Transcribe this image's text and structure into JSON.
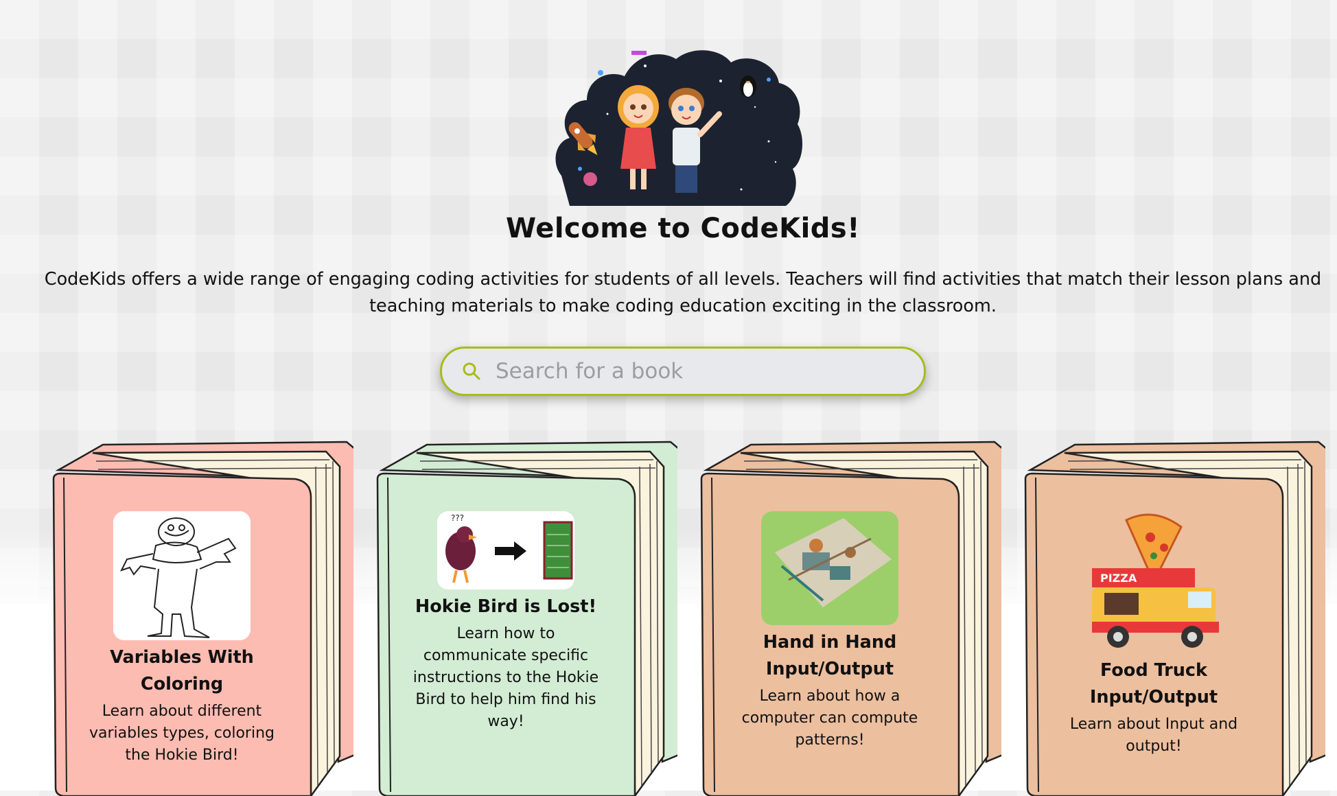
{
  "header": {
    "title": "Welcome to CodeKids!",
    "intro": "CodeKids offers a wide range of engaging coding activities for students of all levels. Teachers will find activities that match their lesson plans and teaching materials to make coding education exciting in the classroom."
  },
  "search": {
    "placeholder": "Search for a book",
    "icon": "search-icon"
  },
  "books": [
    {
      "title": "Variables With Coloring",
      "description": "Learn about different variables types, coloring the Hokie Bird!",
      "cover_color": "#fdbcb1",
      "spine_color": "#f2a89c",
      "image": "hokie-bird-coloring-outline"
    },
    {
      "title": "Hokie Bird is Lost!",
      "description": "Learn how to communicate specific instructions to the Hokie Bird to help him find his way!",
      "cover_color": "#d3ecd4",
      "spine_color": "#bfe0c1",
      "image": "hokie-bird-to-field"
    },
    {
      "title": "Hand in Hand Input/Output",
      "description": "Learn about how a computer can compute patterns!",
      "cover_color": "#ecbf9f",
      "spine_color": "#e0ad8a",
      "image": "playground-aerial"
    },
    {
      "title": "Food Truck Input/Output",
      "description": "Learn about Input and output!",
      "cover_color": "#ecbf9f",
      "spine_color": "#e0ad8a",
      "image": "pizza-food-truck"
    }
  ],
  "colors": {
    "search_border": "#a8bb1a",
    "hero_background": "#1c2230"
  }
}
